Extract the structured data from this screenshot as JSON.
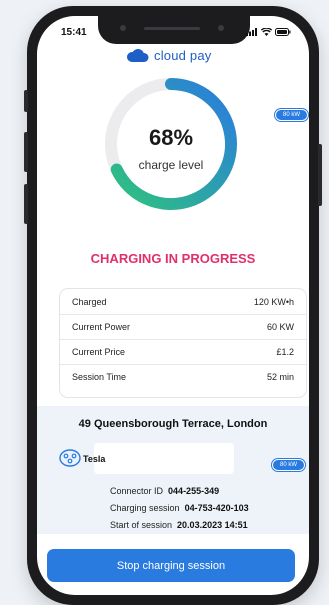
{
  "status_bar": {
    "time": "15:41"
  },
  "brand": {
    "name": "cloud pay"
  },
  "gauge": {
    "percent_text": "68%",
    "label": "charge level",
    "fraction": 0.68
  },
  "power_badge": "80 kW",
  "status_title": "CHARGING IN PROGRESS",
  "stats": [
    {
      "label": "Charged",
      "value": "120 KW•h"
    },
    {
      "label": "Current Power",
      "value": "60 KW"
    },
    {
      "label": "Current Price",
      "value": "£1.2"
    },
    {
      "label": "Session Time",
      "value": "52 min"
    }
  ],
  "station": {
    "address": "49 Queensborough Terrace, London",
    "vehicle": "Tesla",
    "vehicle_badge": "80 kW",
    "details": [
      {
        "label": "Connector ID",
        "value": "044-255-349"
      },
      {
        "label": "Charging session",
        "value": "04-753-420-103"
      },
      {
        "label": "Start of session",
        "value": "20.03.2023 14:51"
      }
    ]
  },
  "actions": {
    "stop_label": "Stop charging session"
  },
  "colors": {
    "accent": "#2a7be0",
    "status": "#e0306a",
    "gauge_start": "#2ec27e",
    "gauge_end": "#2a7be0",
    "track": "#ececee"
  }
}
